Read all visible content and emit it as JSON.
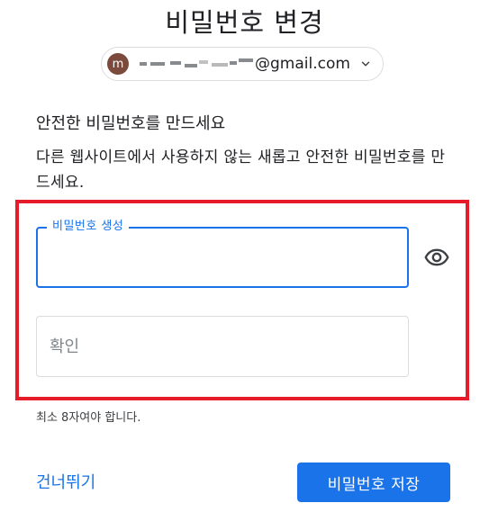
{
  "header": {
    "title": "비밀번호 변경"
  },
  "account": {
    "avatar_letter": "m",
    "email_domain": "@gmail.com",
    "avatar_color": "#7b4a3c",
    "chevron_icon": "chevron-down-icon"
  },
  "section": {
    "heading": "안전한 비밀번호를 만드세요",
    "description": "다른 웹사이트에서 사용하지 않는 새롭고 안전한 비밀번호를 만드세요."
  },
  "form": {
    "new_password_label": "비밀번호 생성",
    "new_password_value": "",
    "confirm_placeholder": "확인",
    "confirm_value": "",
    "visibility_icon": "eye-icon",
    "helper_text": "최소 8자여야 합니다."
  },
  "actions": {
    "skip_label": "건너뛰기",
    "save_label": "비밀번호 저장",
    "accent_color": "#1a73e8"
  },
  "annotation": {
    "highlight_color": "#e61c2b"
  }
}
